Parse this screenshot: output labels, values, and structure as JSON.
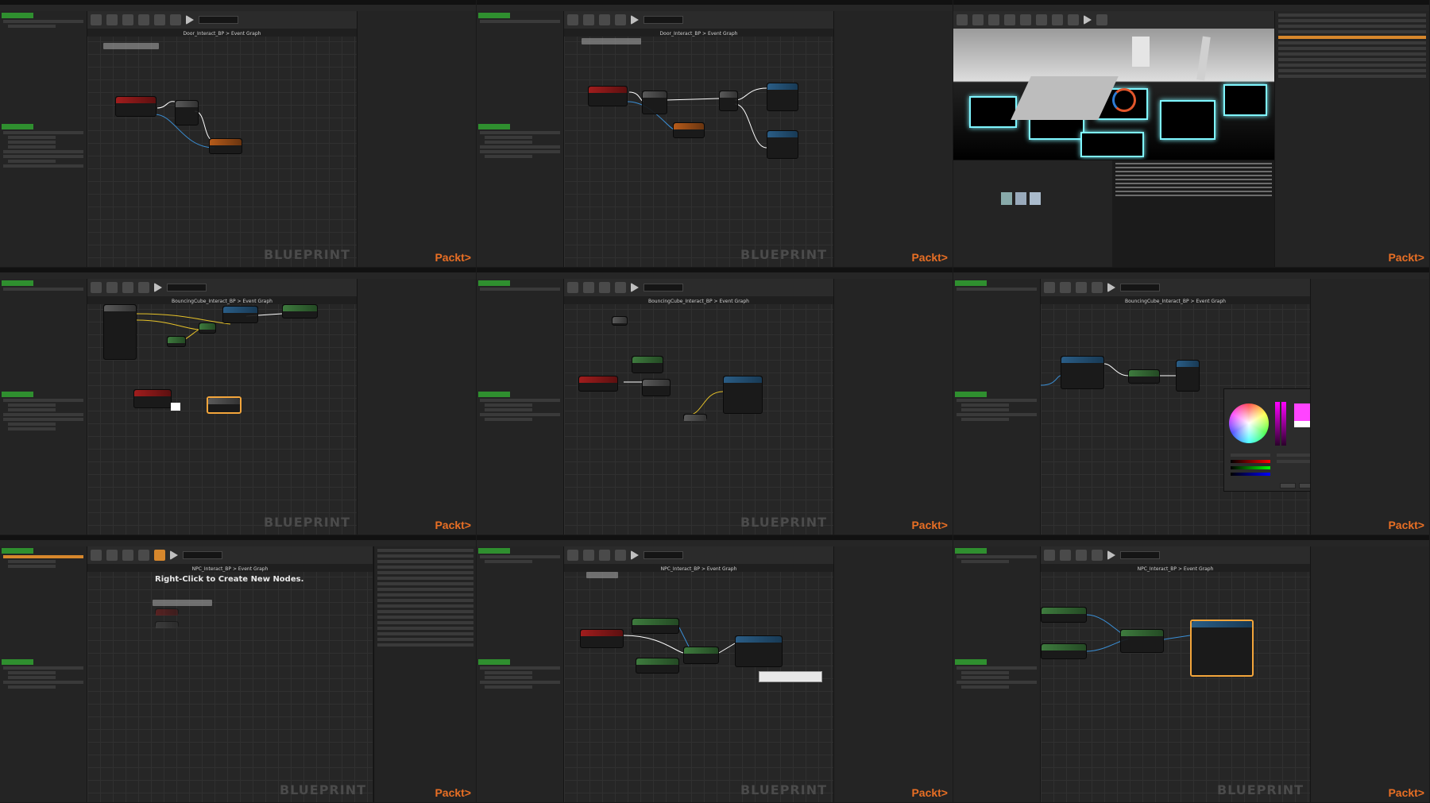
{
  "tiles": [
    {
      "id": "t1",
      "breadcrumb": "Door_Interact_BP > Event Graph",
      "watermark": "BLUEPRINT",
      "brand": "Packt>"
    },
    {
      "id": "t2",
      "breadcrumb": "Door_Interact_BP > Event Graph",
      "watermark": "BLUEPRINT",
      "brand": "Packt>"
    },
    {
      "id": "t3",
      "breadcrumb": "",
      "watermark": "",
      "brand": "Packt>"
    },
    {
      "id": "t4",
      "breadcrumb": "BouncingCube_Interact_BP > Event Graph",
      "watermark": "BLUEPRINT",
      "brand": "Packt>"
    },
    {
      "id": "t5",
      "breadcrumb": "BouncingCube_Interact_BP > Event Graph",
      "watermark": "BLUEPRINT",
      "brand": "Packt>"
    },
    {
      "id": "t6",
      "breadcrumb": "BouncingCube_Interact_BP > Event Graph",
      "watermark": "",
      "brand": "Packt>"
    },
    {
      "id": "t7",
      "breadcrumb": "NPC_Interact_BP > Event Graph",
      "watermark": "BLUEPRINT",
      "brand": "Packt>",
      "hint": "Right-Click to Create New Nodes."
    },
    {
      "id": "t8",
      "breadcrumb": "NPC_Interact_BP > Event Graph",
      "watermark": "BLUEPRINT",
      "brand": "Packt>"
    },
    {
      "id": "t9",
      "breadcrumb": "NPC_Interact_BP > Event Graph",
      "watermark": "BLUEPRINT",
      "brand": "Packt>"
    }
  ],
  "colors": {
    "accent": "#e96f24",
    "selection": "#f3a53b",
    "event": "#a11d1d",
    "function": "#2a5d86",
    "pure": "#3e7b3e",
    "exec": "#ffffff",
    "hex_glow": "#7ff6ff"
  },
  "icons": [
    "play-icon",
    "save-icon",
    "compile-icon",
    "search-icon",
    "settings-icon"
  ]
}
